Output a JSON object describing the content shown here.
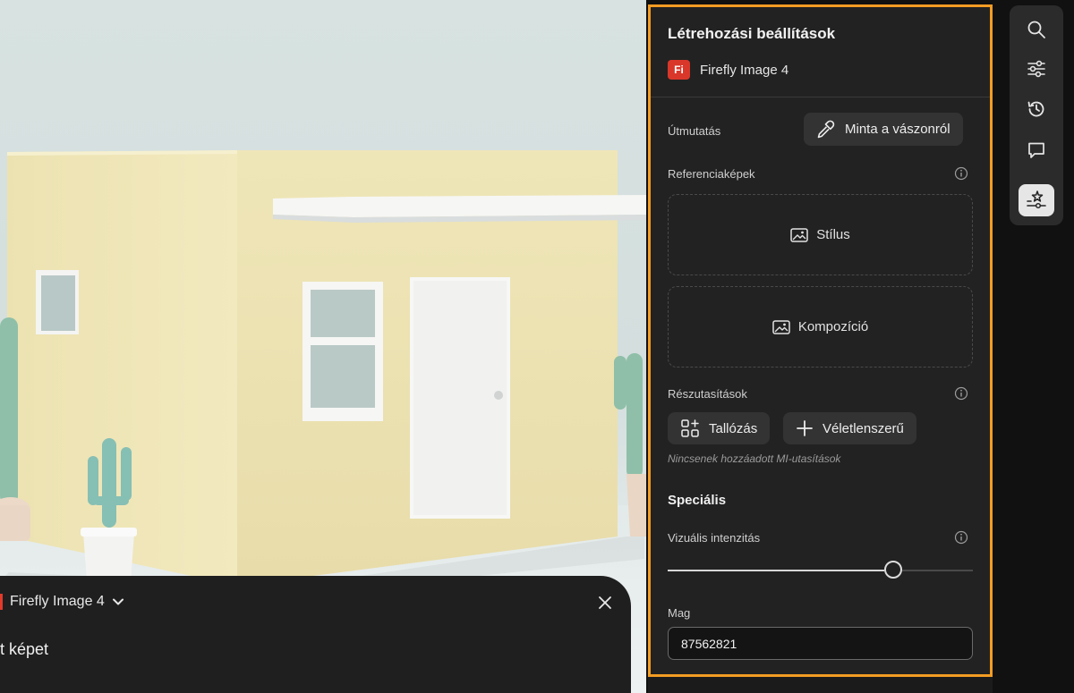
{
  "panel": {
    "title": "Létrehozási beállítások",
    "model_badge": "Fi",
    "model_name": "Firefly Image 4",
    "guidance_label": "Útmutatás",
    "sample_button_label": "Minta a vászonról",
    "reference_label": "Referenciaképek",
    "style_label": "Stílus",
    "composition_label": "Kompozíció",
    "sub_prompts_label": "Részutasítások",
    "browse_label": "Tallózás",
    "random_label": "Véletlenszerű",
    "no_prompts_text": "Nincsenek hozzáadott MI-utasítások",
    "advanced_title": "Speciális",
    "visual_intensity_label": "Vizuális intenzitás",
    "visual_intensity_value": 0.74,
    "seed_label": "Mag",
    "seed_value": "87562821"
  },
  "prompt_bar": {
    "model_label": "Firefly Image 4",
    "prompt_text": "t képet"
  },
  "toolbar": {
    "items": [
      "search-icon",
      "sliders-icon",
      "history-icon",
      "comment-icon",
      "generation-settings-icon"
    ],
    "active": "generation-settings-icon"
  },
  "colors": {
    "highlight_border": "#f39c23",
    "panel_bg": "#222222",
    "brand_red": "#d9372a"
  }
}
